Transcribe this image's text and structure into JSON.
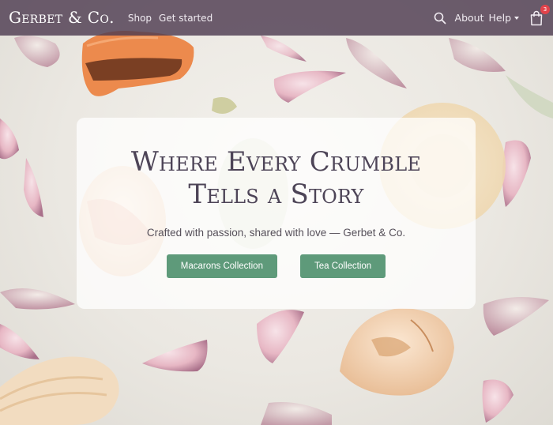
{
  "brand": {
    "name": "Gerbet & Co."
  },
  "nav": {
    "links": [
      "Shop",
      "Get started"
    ],
    "right_links": {
      "about": "About",
      "help": "Help"
    },
    "cart_count": "3",
    "icons": {
      "search": "search-icon",
      "cart": "shopping-bag-icon",
      "help_dropdown": "caret-down-icon"
    }
  },
  "hero": {
    "title_line1": "Where Every Crumble",
    "title_line2": "Tells a Story",
    "subtitle": "Crafted with passion, shared with love — Gerbet & Co.",
    "buttons": [
      "Macarons Collection",
      "Tea Collection"
    ]
  },
  "colors": {
    "navbar": "#4e3c50",
    "accent_button": "#5e9a7a",
    "title_text": "#4d4457",
    "badge": "#e2434b"
  }
}
